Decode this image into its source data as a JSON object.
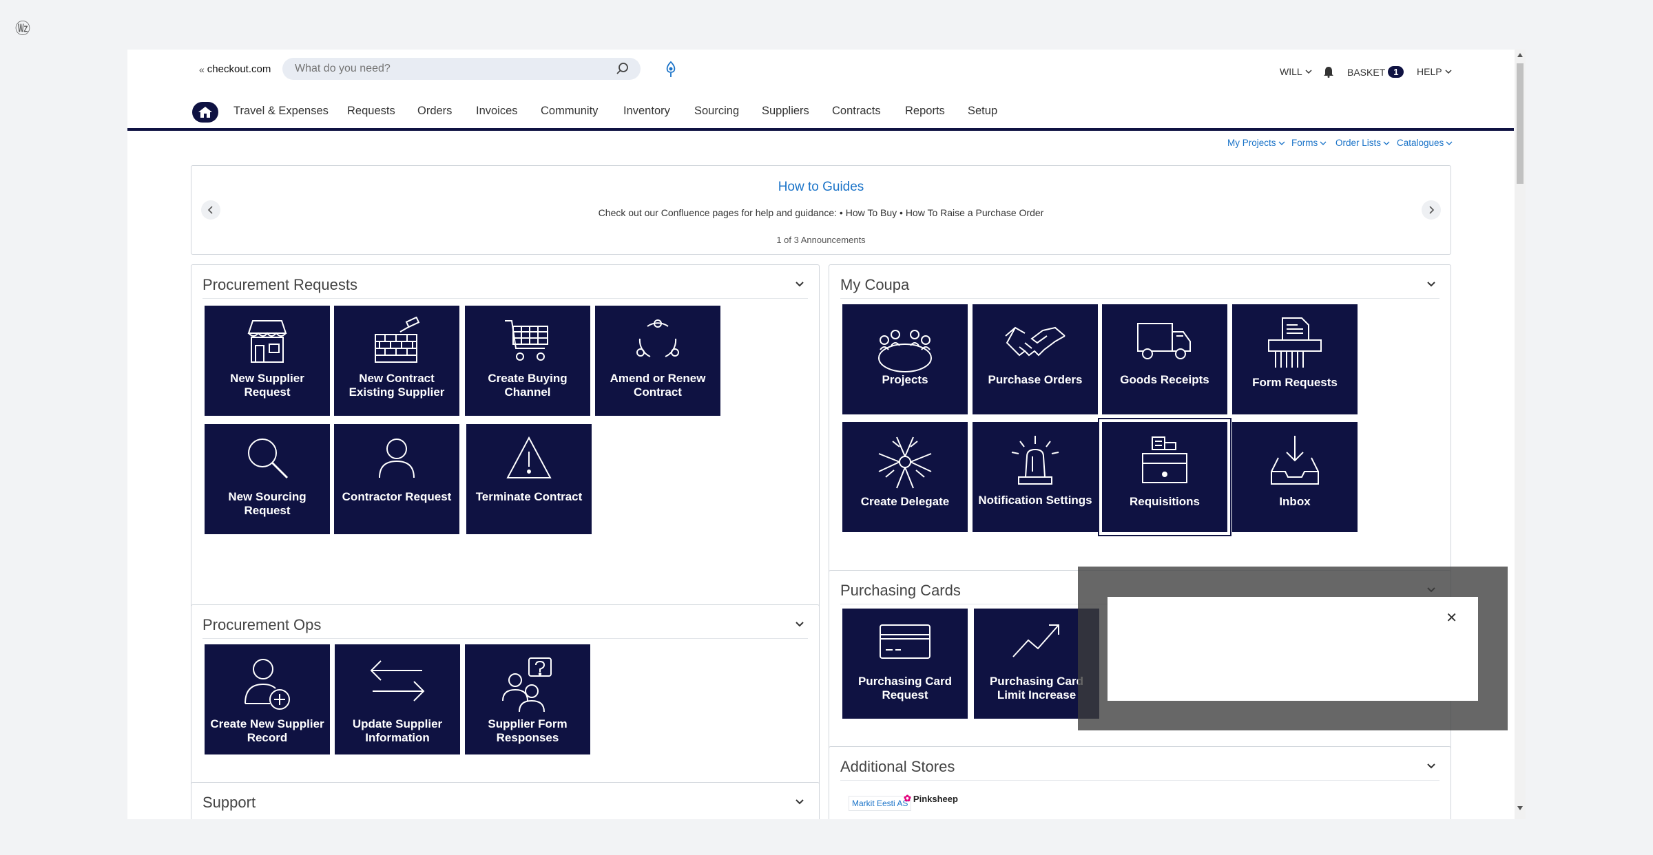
{
  "header": {
    "logo_text": "checkout.com",
    "search_placeholder": "What do you need?",
    "user": "WILL",
    "basket_label": "BASKET",
    "basket_count": "1",
    "help": "HELP"
  },
  "nav": {
    "items": [
      "Travel & Expenses",
      "Requests",
      "Orders",
      "Invoices",
      "Community",
      "Inventory",
      "Sourcing",
      "Suppliers",
      "Contracts",
      "Reports",
      "Setup"
    ]
  },
  "quick_links": [
    "My Projects",
    "Forms",
    "Order Lists",
    "Catalogues"
  ],
  "announcement": {
    "title": "How to Guides",
    "body": "Check out our Confluence pages for help and guidance: • How To Buy • How To Raise a Purchase Order",
    "count": "1 of 3 Announcements"
  },
  "panels": {
    "procurement_requests": {
      "title": "Procurement Requests",
      "tiles": [
        {
          "label": "New Supplier Request",
          "icon": "store-icon"
        },
        {
          "label": "New Contract Existing Supplier",
          "icon": "brick-wall-icon"
        },
        {
          "label": "Create Buying Channel",
          "icon": "shopping-cart-icon"
        },
        {
          "label": "Amend or Renew Contract",
          "icon": "cycle-icon"
        },
        {
          "label": "New Sourcing Request",
          "icon": "magnifier-icon"
        },
        {
          "label": "Contractor Request",
          "icon": "person-icon"
        },
        {
          "label": "Terminate Contract",
          "icon": "warning-icon"
        }
      ]
    },
    "my_coupa": {
      "title": "My Coupa",
      "tiles": [
        {
          "label": "Projects",
          "icon": "meeting-table-icon"
        },
        {
          "label": "Purchase Orders",
          "icon": "handshake-icon"
        },
        {
          "label": "Goods Receipts",
          "icon": "truck-icon"
        },
        {
          "label": "Form Requests",
          "icon": "shredder-icon"
        },
        {
          "label": "Create Delegate",
          "icon": "team-hands-icon"
        },
        {
          "label": "Notification Settings",
          "icon": "siren-icon"
        },
        {
          "label": "Requisitions",
          "icon": "cash-register-icon"
        },
        {
          "label": "Inbox",
          "icon": "inbox-icon"
        }
      ]
    },
    "procurement_ops": {
      "title": "Procurement Ops",
      "tiles": [
        {
          "label": "Create New Supplier Record",
          "icon": "add-user-icon"
        },
        {
          "label": "Update Supplier Information",
          "icon": "arrows-exchange-icon"
        },
        {
          "label": "Supplier Form Responses",
          "icon": "people-question-icon"
        }
      ]
    },
    "purchasing_cards": {
      "title": "Purchasing Cards",
      "tiles": [
        {
          "label": "Purchasing Card Request",
          "icon": "credit-card-icon"
        },
        {
          "label": "Purchasing Card Limit Increase",
          "icon": "chart-up-icon"
        }
      ]
    },
    "support": {
      "title": "Support"
    },
    "additional_stores": {
      "title": "Additional Stores",
      "stores": [
        "Markit Eesti AS",
        "Pinksheep"
      ]
    }
  },
  "colors": {
    "tile_bg": "#0f1242",
    "accent": "#1a73c8",
    "overlay": "#5a5a5a"
  }
}
